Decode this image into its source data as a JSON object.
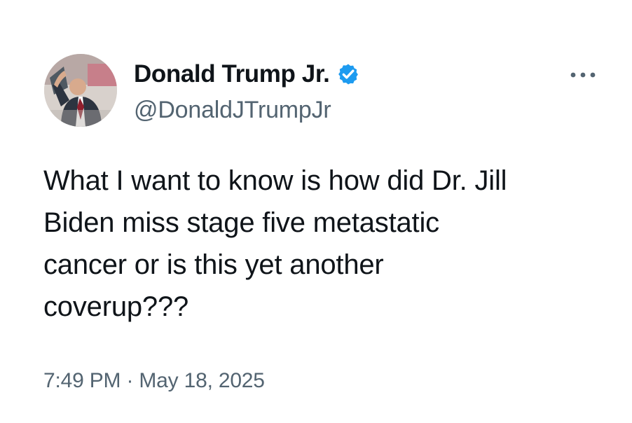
{
  "tweet": {
    "author": {
      "display_name": "Donald Trump Jr.",
      "handle": "@DonaldJTrumpJr",
      "verified_icon": "verified-badge-icon",
      "avatar_icon": "profile-avatar"
    },
    "menu_icon": "more-options-icon",
    "text_lines": [
      "What I want to know is how did Dr. Jill",
      "Biden miss stage five metastatic",
      "cancer or is this yet another",
      "coverup???"
    ],
    "timestamp": "7:49 PM · May 18, 2025"
  },
  "colors": {
    "background": "#ffffff",
    "primary_text": "#0f1419",
    "secondary_text": "#536471",
    "verified_blue": "#1d9bf0"
  }
}
